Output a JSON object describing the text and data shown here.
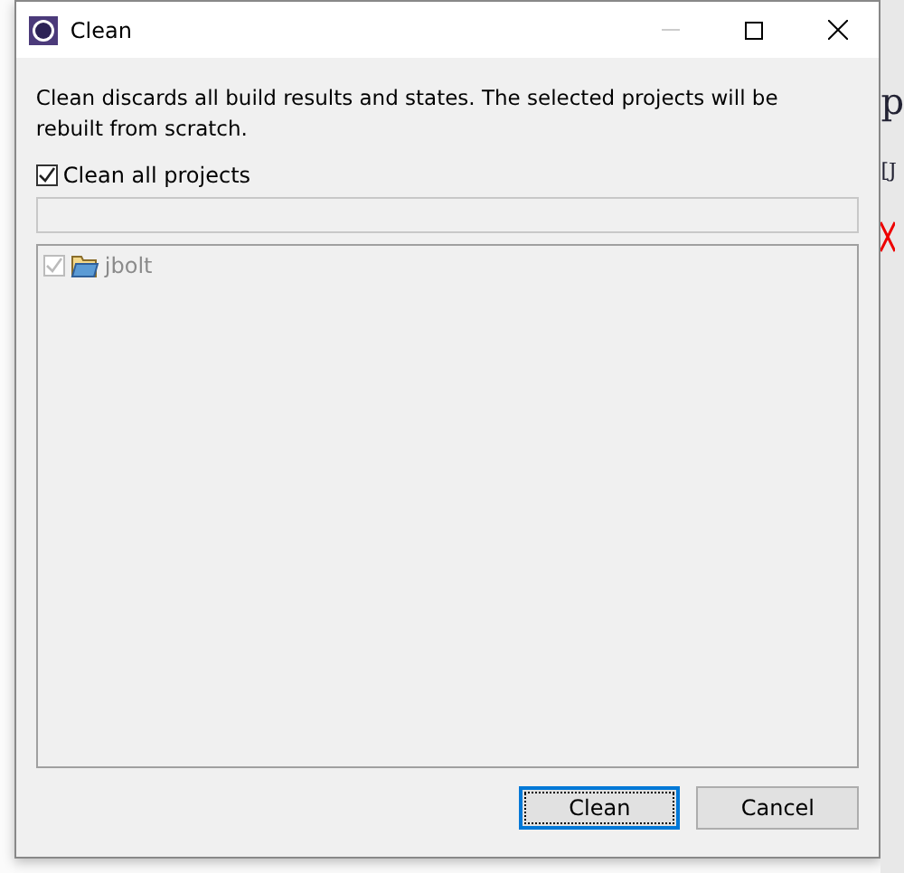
{
  "window": {
    "title": "Clean"
  },
  "description": "Clean discards all build results and states. The selected projects will be rebuilt from scratch.",
  "clean_all": {
    "label": "Clean all projects",
    "checked": true
  },
  "projects": [
    {
      "name": "jbolt",
      "checked": true,
      "disabled": true
    }
  ],
  "buttons": [
    {
      "label": "Clean",
      "default": true
    },
    {
      "label": "Cancel",
      "default": false
    }
  ],
  "background": {
    "texts": [
      "p",
      "[J"
    ]
  }
}
